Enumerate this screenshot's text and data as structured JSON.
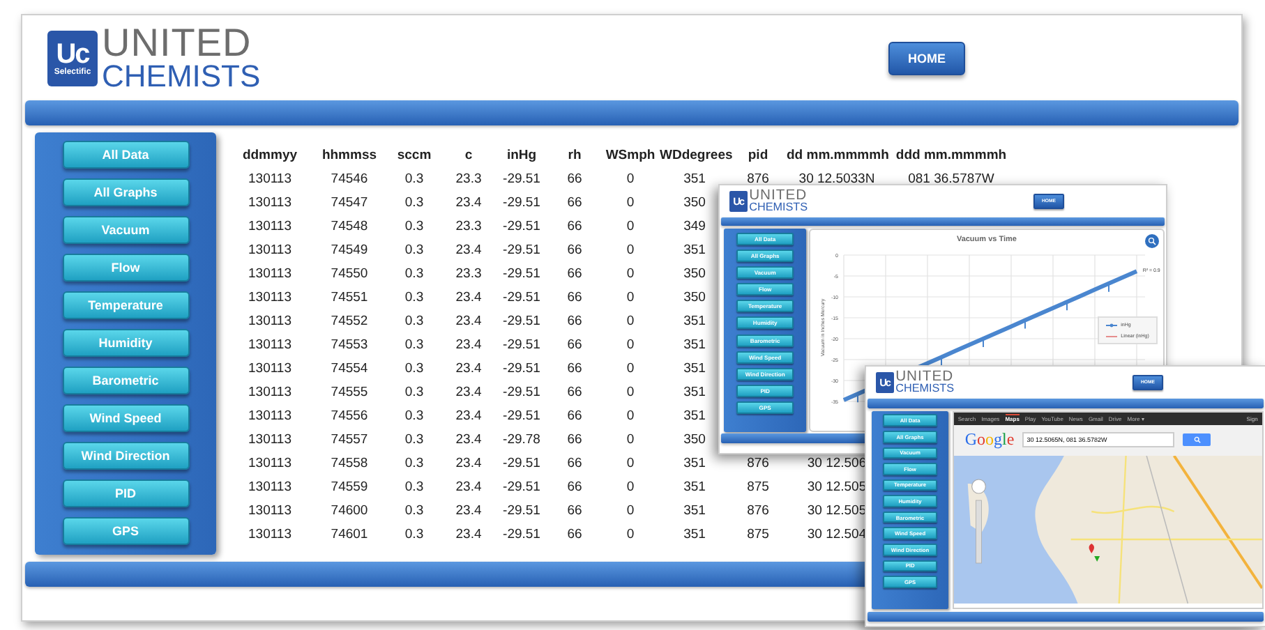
{
  "main": {
    "logo": {
      "mark": "Uc",
      "tagline": "Selectific",
      "line1": "UNITED",
      "line2": "CHEMISTS"
    },
    "home_button": "HOME",
    "nav": [
      "All Data",
      "All Graphs",
      "Vacuum",
      "Flow",
      "Temperature",
      "Humidity",
      "Barometric",
      "Wind Speed",
      "Wind Direction",
      "PID",
      "GPS"
    ],
    "table": {
      "columns": [
        "ddmmyy",
        "hhmmss",
        "sccm",
        "c",
        "inHg",
        "rh",
        "WSmph",
        "WDdegrees",
        "pid",
        "dd mm.mmmmh",
        "ddd mm.mmmmh"
      ],
      "rows": [
        [
          "130113",
          "74546",
          "0.3",
          "23.3",
          "-29.51",
          "66",
          "0",
          "351",
          "876",
          "30 12.5033N",
          "081 36.5787W"
        ],
        [
          "130113",
          "74547",
          "0.3",
          "23.4",
          "-29.51",
          "66",
          "0",
          "350"
        ],
        [
          "130113",
          "74548",
          "0.3",
          "23.3",
          "-29.51",
          "66",
          "0",
          "349"
        ],
        [
          "130113",
          "74549",
          "0.3",
          "23.4",
          "-29.51",
          "66",
          "0",
          "351"
        ],
        [
          "130113",
          "74550",
          "0.3",
          "23.3",
          "-29.51",
          "66",
          "0",
          "350"
        ],
        [
          "130113",
          "74551",
          "0.3",
          "23.4",
          "-29.51",
          "66",
          "0",
          "350"
        ],
        [
          "130113",
          "74552",
          "0.3",
          "23.4",
          "-29.51",
          "66",
          "0",
          "351"
        ],
        [
          "130113",
          "74553",
          "0.3",
          "23.4",
          "-29.51",
          "66",
          "0",
          "351"
        ],
        [
          "130113",
          "74554",
          "0.3",
          "23.4",
          "-29.51",
          "66",
          "0",
          "351"
        ],
        [
          "130113",
          "74555",
          "0.3",
          "23.4",
          "-29.51",
          "66",
          "0",
          "351"
        ],
        [
          "130113",
          "74556",
          "0.3",
          "23.4",
          "-29.51",
          "66",
          "0",
          "351"
        ],
        [
          "130113",
          "74557",
          "0.3",
          "23.4",
          "-29.78",
          "66",
          "0",
          "350"
        ],
        [
          "130113",
          "74558",
          "0.3",
          "23.4",
          "-29.51",
          "66",
          "0",
          "351",
          "876",
          "30 12.506"
        ],
        [
          "130113",
          "74559",
          "0.3",
          "23.4",
          "-29.51",
          "66",
          "0",
          "351",
          "875",
          "30 12.505"
        ],
        [
          "130113",
          "74600",
          "0.3",
          "23.4",
          "-29.51",
          "66",
          "0",
          "351",
          "876",
          "30 12.505"
        ],
        [
          "130113",
          "74601",
          "0.3",
          "23.4",
          "-29.51",
          "66",
          "0",
          "351",
          "875",
          "30 12.504"
        ]
      ]
    }
  },
  "graph_window": {
    "logo": {
      "mark": "Uc",
      "line1": "UNITED",
      "line2": "CHEMISTS"
    },
    "home_button": "HOME",
    "nav": [
      "All Data",
      "All Graphs",
      "Vacuum",
      "Flow",
      "Temperature",
      "Humidity",
      "Barometric",
      "Wind Speed",
      "Wind Direction",
      "PID",
      "GPS"
    ],
    "chart": {
      "title": "Vacuum vs Time",
      "ylabel": "Vacuum in Inches Mercury",
      "yticks": [
        "0",
        "-5",
        "-10",
        "-15",
        "-20",
        "-25",
        "-30",
        "-35"
      ],
      "fit_label": "R² = 0.9",
      "legend": [
        {
          "kind": "series",
          "label": "inHg"
        },
        {
          "kind": "trend",
          "label": "Linear (inHg)"
        }
      ]
    }
  },
  "map_window": {
    "logo": {
      "mark": "Uc",
      "line1": "UNITED",
      "line2": "CHEMISTS"
    },
    "home_button": "HOME",
    "nav": [
      "All Data",
      "All Graphs",
      "Vacuum",
      "Flow",
      "Temperature",
      "Humidity",
      "Barometric",
      "Wind Speed",
      "Wind Direction",
      "PID",
      "GPS"
    ],
    "google": {
      "links": [
        {
          "label": "Search",
          "selected": false
        },
        {
          "label": "Images",
          "selected": false
        },
        {
          "label": "Maps",
          "selected": true
        },
        {
          "label": "Play",
          "selected": false
        },
        {
          "label": "YouTube",
          "selected": false
        },
        {
          "label": "News",
          "selected": false
        },
        {
          "label": "Gmail",
          "selected": false
        },
        {
          "label": "Drive",
          "selected": false
        },
        {
          "label": "More ▾",
          "selected": false
        }
      ],
      "sign_in": "Sign",
      "logo": "Google",
      "query": "30 12.5065N, 081 36.5782W"
    }
  }
}
